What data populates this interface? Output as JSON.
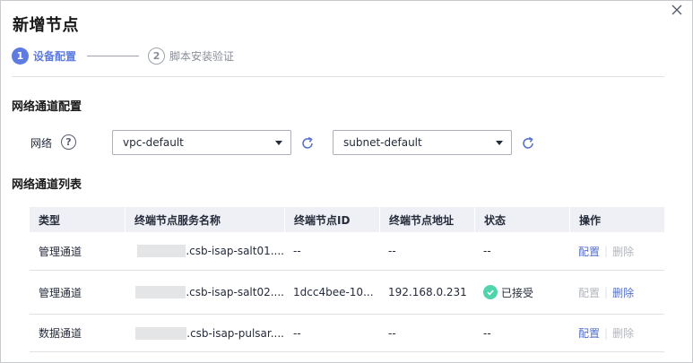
{
  "dialog": {
    "title": "新增节点",
    "close_icon": "close-icon"
  },
  "steps": [
    {
      "number": "1",
      "label": "设备配置",
      "active": true
    },
    {
      "number": "2",
      "label": "脚本安装验证",
      "active": false
    }
  ],
  "network_config": {
    "section_title": "网络通道配置",
    "network_label": "网络",
    "help_glyph": "?",
    "vpc_select": {
      "value": "vpc-default"
    },
    "subnet_select": {
      "value": "subnet-default"
    }
  },
  "channel_list": {
    "section_title": "网络通道列表",
    "columns": [
      "类型",
      "终端节点服务名称",
      "终端节点ID",
      "终端节点地址",
      "状态",
      "操作"
    ],
    "rows": [
      {
        "type": "管理通道",
        "service_name": ".csb-isap-salt01....",
        "endpoint_id": "--",
        "endpoint_address": "--",
        "status": "--",
        "status_ok": false,
        "op_config": "配置",
        "op_delete": "删除",
        "config_enabled": true,
        "delete_enabled": false
      },
      {
        "type": "管理通道",
        "service_name": ".csb-isap-salt02....",
        "endpoint_id": "1dcc4bee-10...",
        "endpoint_address": "192.168.0.231",
        "status": "已接受",
        "status_ok": true,
        "op_config": "配置",
        "op_delete": "删除",
        "config_enabled": false,
        "delete_enabled": true
      },
      {
        "type": "数据通道",
        "service_name": ".csb-isap-pulsar....",
        "endpoint_id": "--",
        "endpoint_address": "--",
        "status": "--",
        "status_ok": false,
        "op_config": "配置",
        "op_delete": "删除",
        "config_enabled": true,
        "delete_enabled": false
      }
    ]
  },
  "colors": {
    "primary": "#5e7ce0",
    "link": "#526ecc",
    "success": "#50d4ab",
    "disabled": "#b2b5bb",
    "header_bg": "#eef0f5"
  }
}
